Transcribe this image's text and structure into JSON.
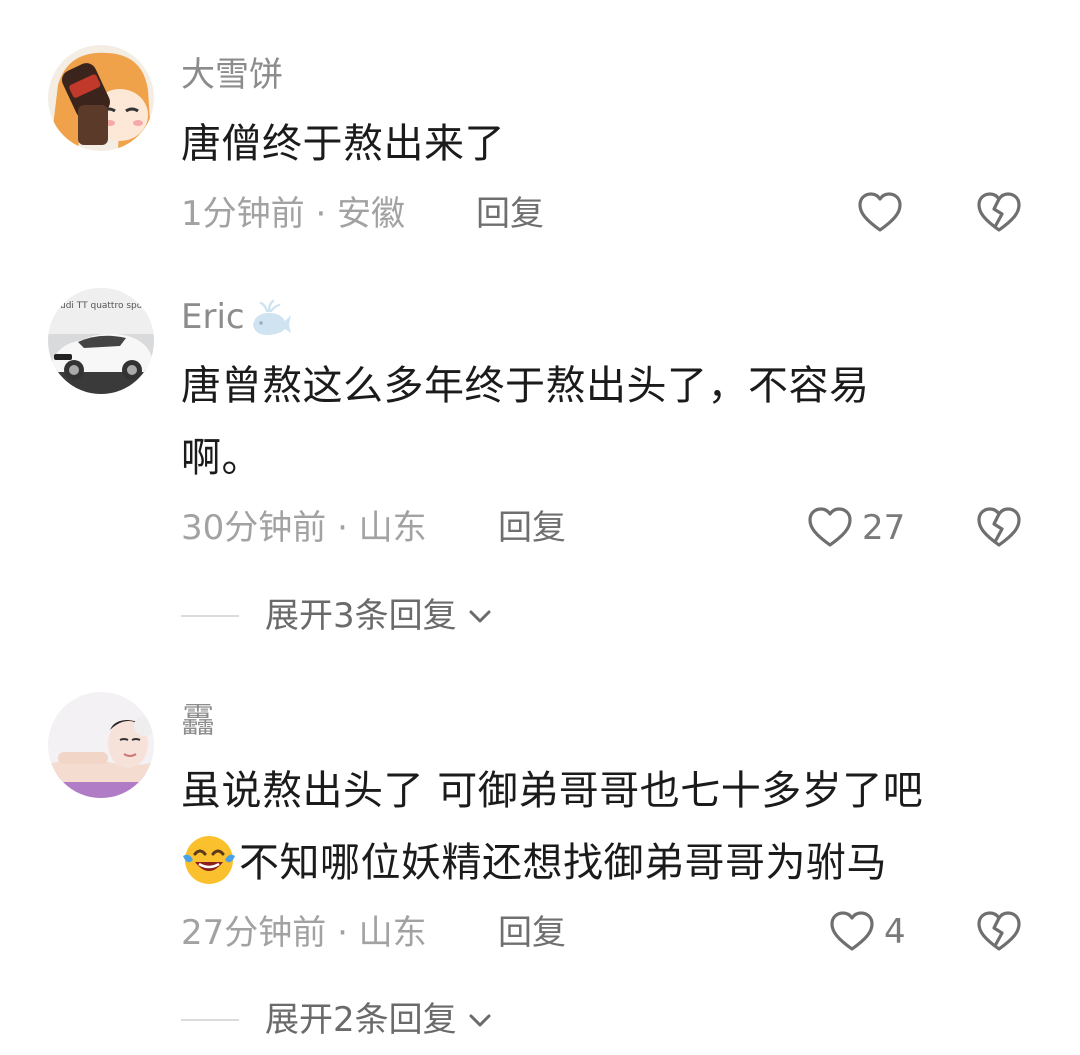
{
  "comments": [
    {
      "author": "大雪饼",
      "avatar_icon": "anime-girl-avatar",
      "lines": [
        "唐僧终于熬出来了"
      ],
      "meta": "1分钟前 · 安徽",
      "reply_label": "回复",
      "like_count": "",
      "expand_label": ""
    },
    {
      "author": "Eric",
      "author_badge_icon": "whale-badge-icon",
      "avatar_icon": "car-photo-avatar",
      "avatar_text": "udi TT quattro sport concept",
      "lines": [
        "唐曾熬这么多年终于熬出头了，不容易",
        "啊。"
      ],
      "meta": "30分钟前 · 山东",
      "reply_label": "回复",
      "like_count": "27",
      "expand_label": "展开3条回复"
    },
    {
      "author": "靐",
      "avatar_icon": "portrait-photo-avatar",
      "lines": [
        "虽说熬出头了 可御弟哥哥也七十多岁了吧",
        "不知哪位妖精还想找御弟哥哥为驸马"
      ],
      "line2_emoji": "laughing-crying-emoji",
      "meta": "27分钟前 · 山东",
      "reply_label": "回复",
      "like_count": "4",
      "expand_label": "展开2条回复"
    }
  ],
  "colors": {
    "author": "#8c8c8c",
    "text": "#1b1b1b",
    "meta": "#a2a2a2",
    "icon": "#6f6f6f"
  }
}
